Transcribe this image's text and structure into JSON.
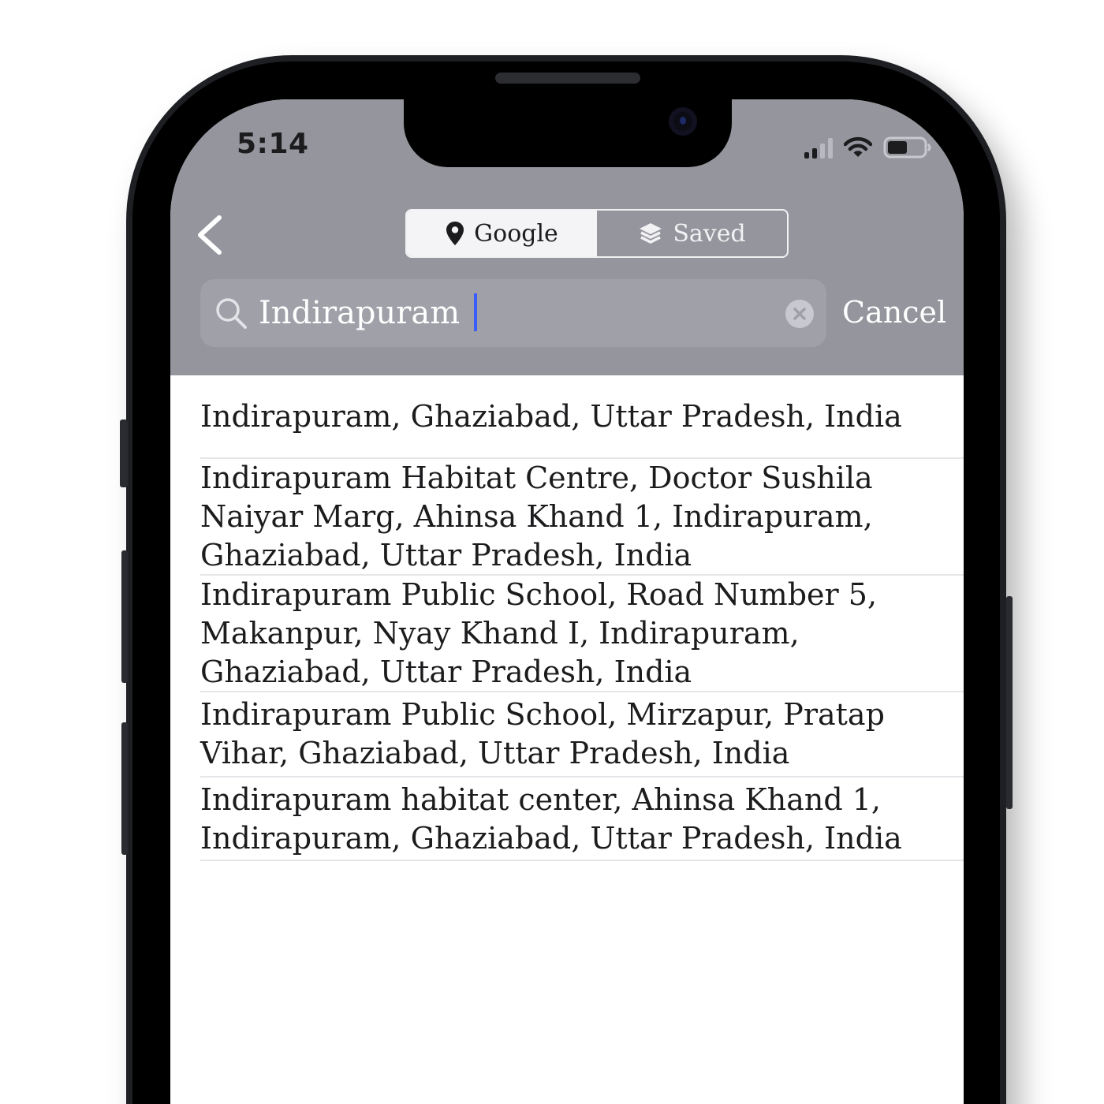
{
  "status_bar": {
    "time": "5:14",
    "icons": [
      "cellular-signal-icon",
      "wifi-icon",
      "battery-icon"
    ]
  },
  "nav": {
    "back_icon": "chevron-left-icon"
  },
  "segmented_control": {
    "options": [
      {
        "label": "Google",
        "icon": "map-pin-icon",
        "selected": true
      },
      {
        "label": "Saved",
        "icon": "layers-icon",
        "selected": false
      }
    ]
  },
  "search": {
    "value": "Indirapuram",
    "cancel_label": "Cancel",
    "search_icon": "search-icon",
    "clear_icon": "clear-icon"
  },
  "results": [
    {
      "text": "Indirapuram, Ghaziabad, Uttar Pradesh, India"
    },
    {
      "text": "Indirapuram Habitat Centre, Doctor Sushila Naiyar Marg, Ahinsa Khand 1, Indirapuram, Ghaziabad, Uttar Pradesh, India"
    },
    {
      "text": "Indirapuram Public School, Road Number 5, Makanpur, Nyay Khand I, Indirapuram, Ghaziabad, Uttar Pradesh, India"
    },
    {
      "text": "Indirapuram Public School, Mirzapur, Pratap Vihar, Ghaziabad, Uttar Pradesh, India"
    },
    {
      "text": "Indirapuram habitat center, Ahinsa Khand 1, Indirapuram, Ghaziabad, Uttar Pradesh, India"
    }
  ],
  "colors": {
    "header_bg": "#94959d",
    "search_field_bg": "#9fa0a8",
    "caret": "#3b5cff",
    "text": "#1c1c1e"
  }
}
